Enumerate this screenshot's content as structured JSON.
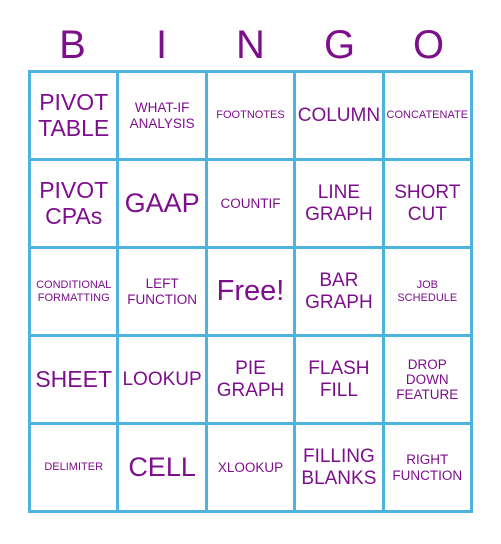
{
  "colors": {
    "text_purple": "#7d0f8c",
    "grid_blue": "#4fb3e0",
    "background": "#ffffff"
  },
  "header": {
    "letters": [
      "B",
      "I",
      "N",
      "G",
      "O"
    ]
  },
  "grid": {
    "rows": 5,
    "columns": 5,
    "free_space": {
      "row": 3,
      "column": 3,
      "label": "Free!"
    },
    "cells": [
      [
        {
          "label": "PIVOT TABLE",
          "size": "lg",
          "free": false
        },
        {
          "label": "WHAT-IF ANALYSIS",
          "size": "sm",
          "free": false
        },
        {
          "label": "FOOTNOTES",
          "size": "xs",
          "free": false
        },
        {
          "label": "COLUMN",
          "size": "md",
          "free": false
        },
        {
          "label": "CONCATENATE",
          "size": "xs",
          "free": false
        }
      ],
      [
        {
          "label": "PIVOT CPAs",
          "size": "lg",
          "free": false
        },
        {
          "label": "GAAP",
          "size": "xl",
          "free": false
        },
        {
          "label": "COUNTIF",
          "size": "sm",
          "free": false
        },
        {
          "label": "LINE GRAPH",
          "size": "md",
          "free": false
        },
        {
          "label": "SHORT CUT",
          "size": "md",
          "free": false
        }
      ],
      [
        {
          "label": "CONDITIONAL FORMATTING",
          "size": "xs",
          "free": false
        },
        {
          "label": "LEFT FUNCTION",
          "size": "sm",
          "free": false
        },
        {
          "label": "Free!",
          "size": "free",
          "free": true
        },
        {
          "label": "BAR GRAPH",
          "size": "md",
          "free": false
        },
        {
          "label": "JOB SCHEDULE",
          "size": "xs",
          "free": false
        }
      ],
      [
        {
          "label": "SHEET",
          "size": "lg",
          "free": false
        },
        {
          "label": "LOOKUP",
          "size": "md",
          "free": false
        },
        {
          "label": "PIE GRAPH",
          "size": "md",
          "free": false
        },
        {
          "label": "FLASH FILL",
          "size": "md",
          "free": false
        },
        {
          "label": "DROP DOWN FEATURE",
          "size": "sm",
          "free": false
        }
      ],
      [
        {
          "label": "DELIMITER",
          "size": "xs",
          "free": false
        },
        {
          "label": "CELL",
          "size": "xl",
          "free": false
        },
        {
          "label": "XLOOKUP",
          "size": "sm",
          "free": false
        },
        {
          "label": "FILLING BLANKS",
          "size": "md",
          "free": false
        },
        {
          "label": "RIGHT FUNCTION",
          "size": "sm",
          "free": false
        }
      ]
    ]
  }
}
